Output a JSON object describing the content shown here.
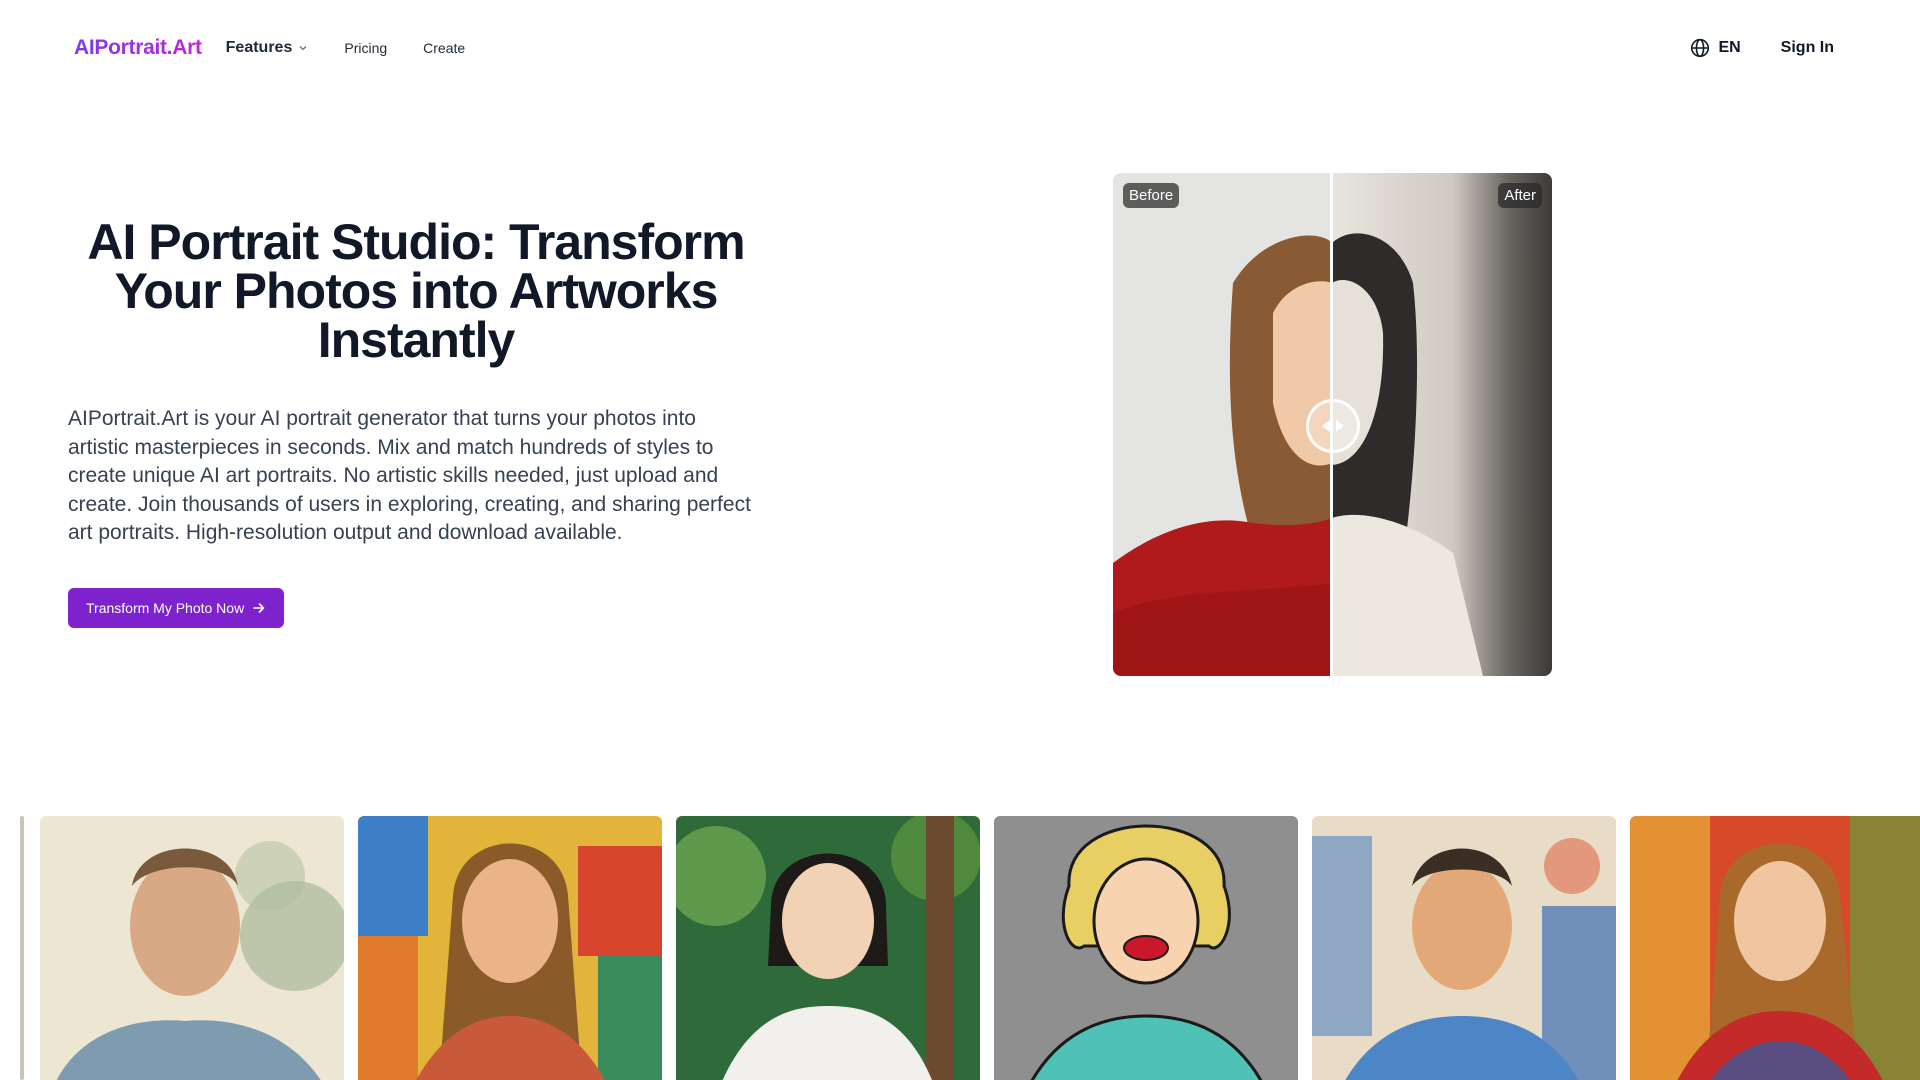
{
  "header": {
    "logo": "AIPortrait.Art",
    "nav": {
      "features": "Features",
      "pricing": "Pricing",
      "create": "Create"
    },
    "language": "EN",
    "sign_in": "Sign In",
    "icons": [
      "chevron-down-icon",
      "globe-icon"
    ]
  },
  "hero": {
    "title": "AI Portrait Studio: Transform Your Photos into Artworks Instantly",
    "description": "AIPortrait.Art is your AI portrait generator that turns your photos into artistic masterpieces in seconds. Mix and match hundreds of styles to create unique AI art portraits. No artistic skills needed, just upload and create. Join thousands of users in exploring, creating, and sharing perfect art portraits. High-resolution output and download available.",
    "cta_label": "Transform My Photo Now",
    "cta_icon": "arrow-right-icon"
  },
  "compare": {
    "before_label": "Before",
    "after_label": "After",
    "handle_icon": "left-right-arrows-icon",
    "split_position": 0.5
  },
  "gallery": {
    "styles": [
      "watercolor",
      "fauvist",
      "anime",
      "pop-art",
      "watercolor-bright",
      "expressionist"
    ]
  },
  "colors": {
    "brand_gradient_start": "#7c3aed",
    "brand_gradient_end": "#c026d3",
    "cta_background": "#7e22ce",
    "text_primary": "#111827",
    "text_body": "#374151"
  }
}
